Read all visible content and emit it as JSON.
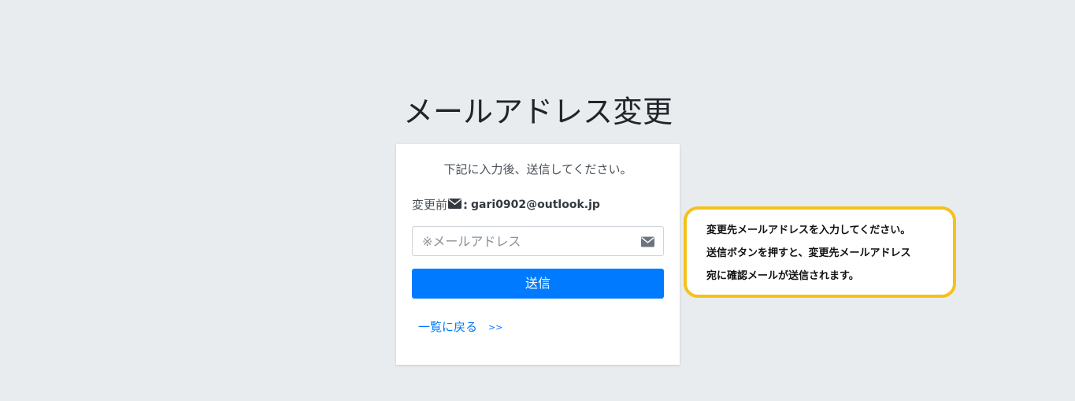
{
  "page": {
    "title": "メールアドレス変更"
  },
  "card": {
    "instruction": "下記に入力後、送信してください。",
    "current_label": "変更前",
    "current_separator": ":",
    "current_email": "gari0902@outlook.jp",
    "email_placeholder": "※メールアドレス",
    "email_value": "",
    "submit_label": "送信",
    "back_link_label": "一覧に戻る",
    "back_link_arrows": ">>"
  },
  "tooltip": {
    "lines": [
      "変更先メールアドレスを入力してください。",
      "送信ボタンを押すと、変更先メールアドレス",
      "宛に確認メールが送信されます。"
    ],
    "border_color": "#f5c11a"
  },
  "icons": {
    "current_email_icon": "envelope-icon",
    "input_icon": "envelope-icon"
  },
  "colors": {
    "background": "#e9ecef",
    "primary": "#007bff",
    "card": "#ffffff"
  }
}
